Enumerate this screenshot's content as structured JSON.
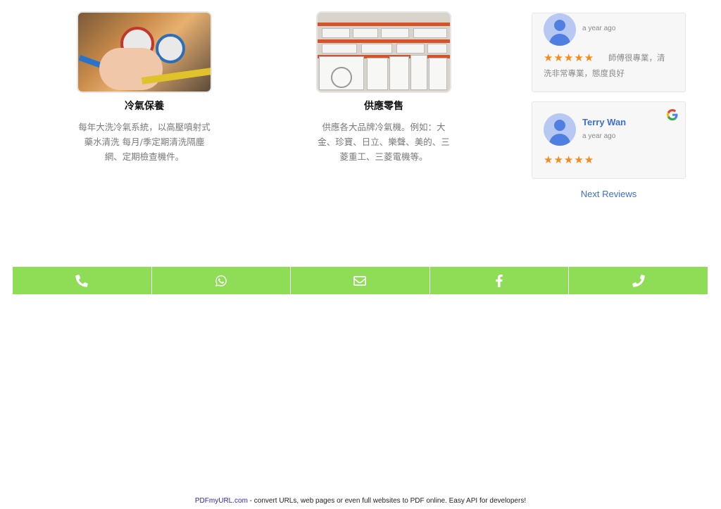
{
  "services": [
    {
      "title": "冷氣保養",
      "desc": "每年大洗冷氣系統，以高壓噴射式藥水清洗 每月/季定期清洗隔塵網、定期檢查機件。"
    },
    {
      "title": "供應零售",
      "desc": "供應各大品牌冷氣機。例如：大金、珍寶、日立、樂聲、美的、三菱重工、三菱電機等。"
    }
  ],
  "reviews": [
    {
      "time": "a year ago",
      "stars": "★★★★★",
      "text": "師傅很專業，清洗非常專業，態度良好"
    },
    {
      "name": "Terry Wan",
      "time": "a year ago",
      "stars": "★★★★★"
    }
  ],
  "next_reviews_label": "Next Reviews",
  "contact_bar": {
    "buttons": [
      "phone-icon",
      "whatsapp-icon",
      "envelope-icon",
      "facebook-icon",
      "phone-alt-icon"
    ],
    "color": "#8fdc57"
  },
  "footer": {
    "link_text": "PDFmyURL.com",
    "text": " - convert URLs, web pages or even full websites to PDF online. Easy API for developers!"
  }
}
